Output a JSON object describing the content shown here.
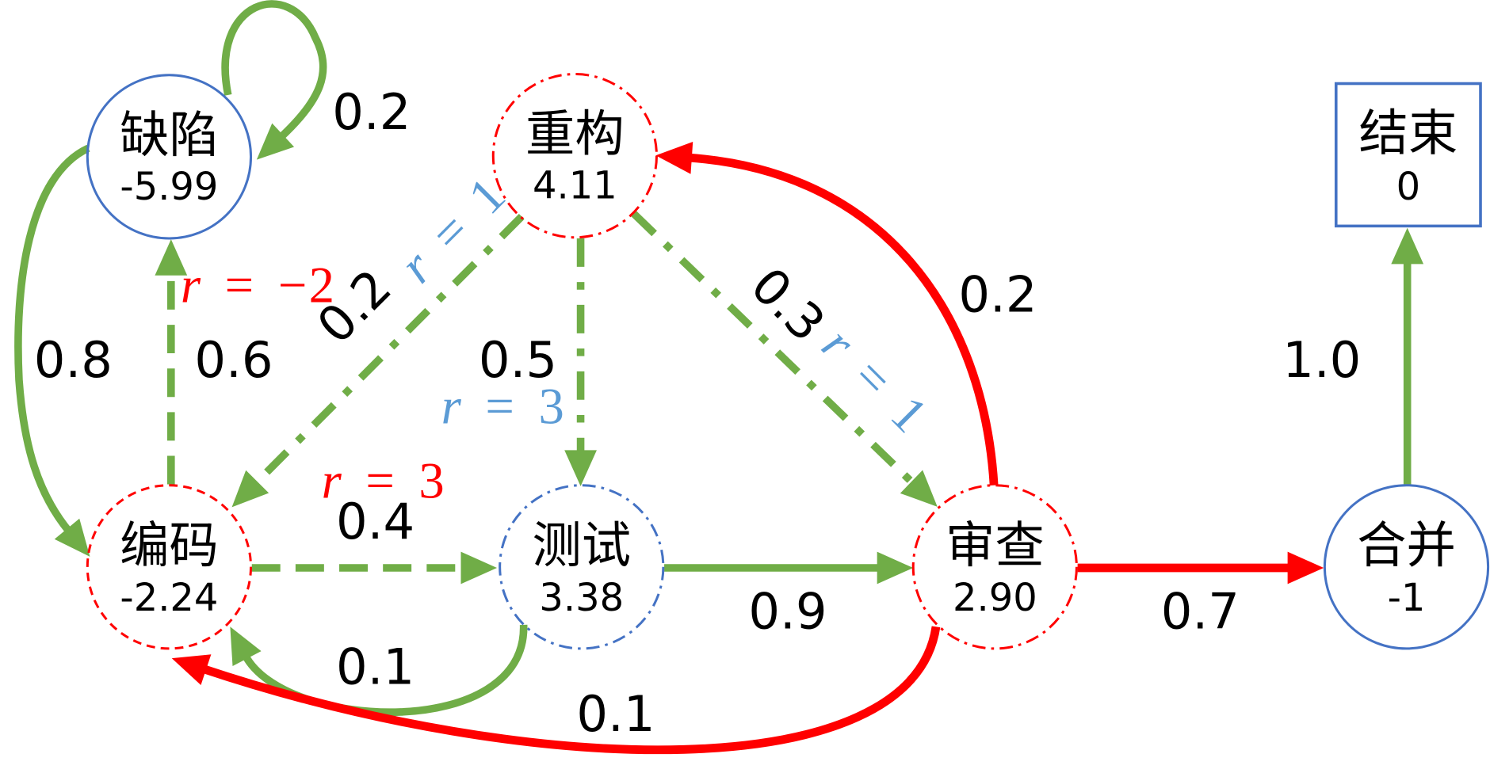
{
  "colors": {
    "transition_green": "#70AD47",
    "transition_red": "#FF0000",
    "node_border_blue": "#4472C4",
    "node_border_red": "#FF0000",
    "reward_blue": "#5B9BD5",
    "reward_red": "#FF0000",
    "text": "#000000"
  },
  "nodes": {
    "defect": {
      "name": "缺陷",
      "value": "-5.99"
    },
    "refactor": {
      "name": "重构",
      "value": "4.11"
    },
    "end": {
      "name": "结束",
      "value": "0"
    },
    "coding": {
      "name": "编码",
      "value": "-2.24"
    },
    "testing": {
      "name": "测试",
      "value": "3.38"
    },
    "review": {
      "name": "审查",
      "value": "2.90"
    },
    "merge": {
      "name": "合并",
      "value": "-1"
    }
  },
  "edges": {
    "defect_to_defect": {
      "prob": "0.2"
    },
    "defect_to_coding": {
      "prob": "0.8"
    },
    "coding_to_defect": {
      "prob": "0.6",
      "reward": "r = −2"
    },
    "refactor_to_coding": {
      "prob": "0.2",
      "reward": "r = 1"
    },
    "refactor_to_testing": {
      "prob": "0.5",
      "reward": "r = 3"
    },
    "refactor_to_review": {
      "prob": "0.3",
      "reward": "r = 1"
    },
    "coding_to_testing": {
      "prob": "0.4",
      "reward": "r = 3"
    },
    "testing_to_coding": {
      "prob": "0.1"
    },
    "testing_to_review": {
      "prob": "0.9"
    },
    "review_to_refactor": {
      "prob": "0.2"
    },
    "review_to_coding": {
      "prob": "0.1"
    },
    "review_to_merge": {
      "prob": "0.7"
    },
    "merge_to_end": {
      "prob": "1.0"
    }
  }
}
